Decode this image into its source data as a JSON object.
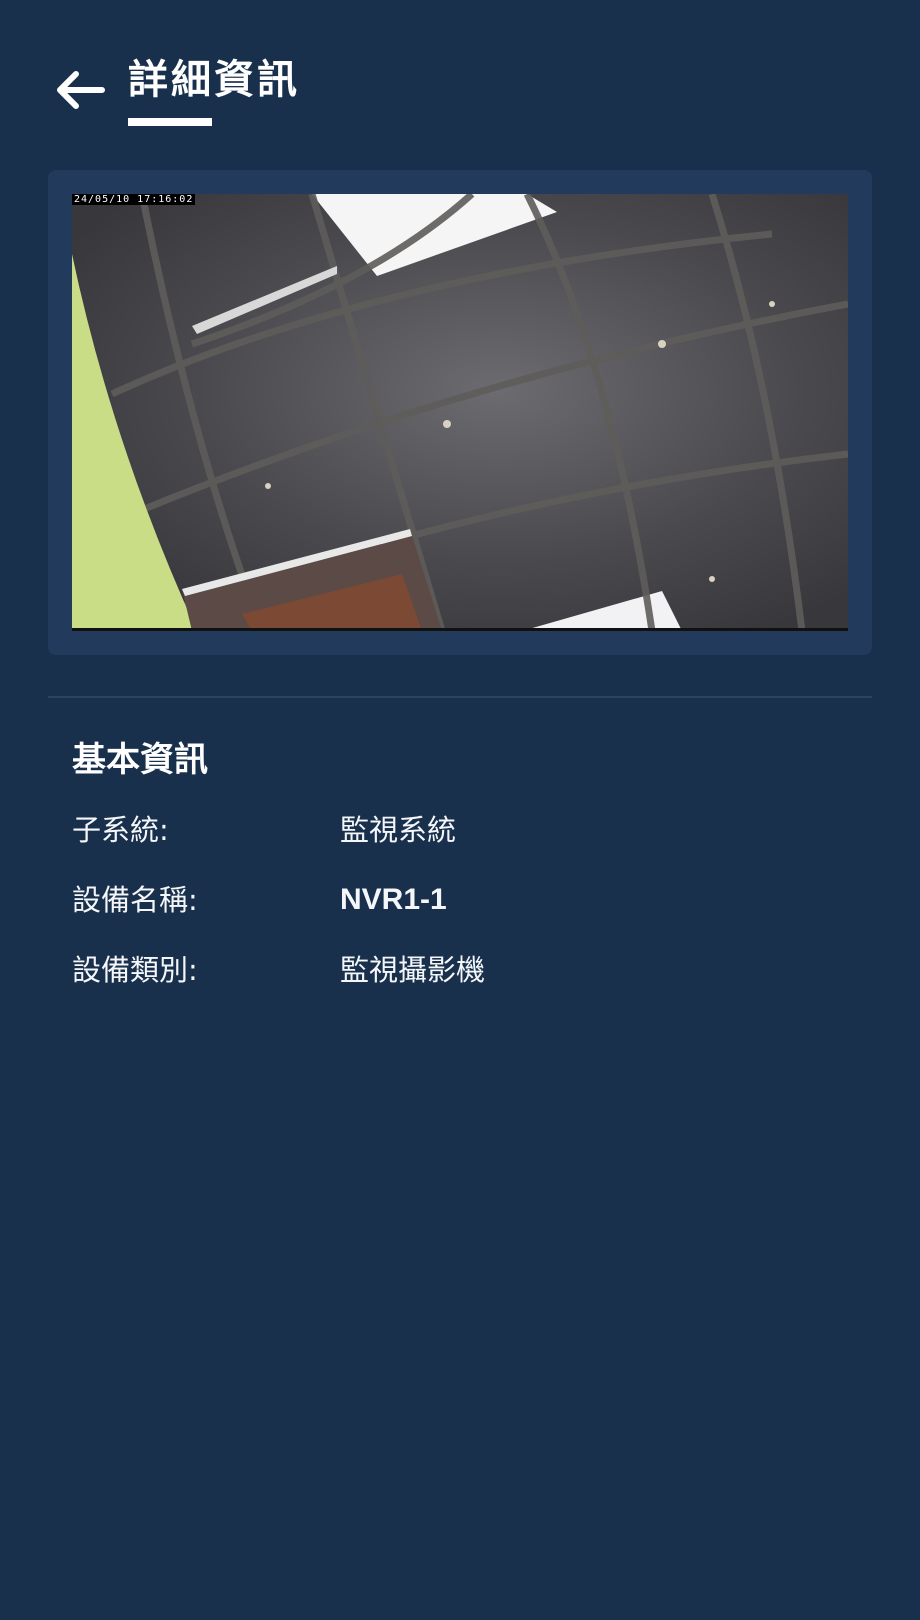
{
  "header": {
    "title": "詳細資訊",
    "back_icon": "arrow-left-icon"
  },
  "video": {
    "timestamp": "24/05/10 17:16:02"
  },
  "basic_info": {
    "section_title": "基本資訊",
    "rows": [
      {
        "label": "子系統:",
        "value": "監視系統"
      },
      {
        "label": "設備名稱:",
        "value": "NVR1-1"
      },
      {
        "label": "設備類別:",
        "value": "監視攝影機"
      }
    ]
  },
  "colors": {
    "background": "#19304c",
    "card": "#223b5c",
    "text": "#ffffff"
  }
}
